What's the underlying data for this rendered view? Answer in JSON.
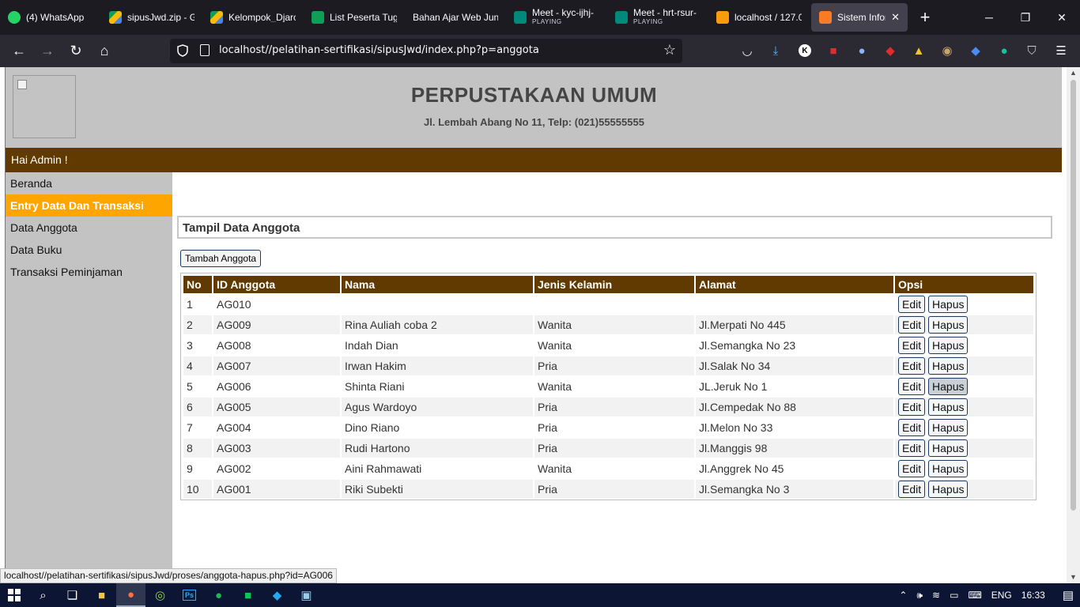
{
  "browser": {
    "tabs": [
      {
        "title": "(4) WhatsApp",
        "sub": "",
        "color": "#25d366"
      },
      {
        "title": "sipusJwd.zip - G",
        "sub": "",
        "color": "#fbbc04"
      },
      {
        "title": "Kelompok_Djarc",
        "sub": "",
        "color": "#34a853"
      },
      {
        "title": "List Peserta Tug",
        "sub": "",
        "color": "#0f9d58"
      },
      {
        "title": "Bahan Ajar Web Jun",
        "sub": "",
        "color": ""
      },
      {
        "title": "Meet - kyc-ijhj-",
        "sub": "PLAYING",
        "color": "#00897b"
      },
      {
        "title": "Meet - hrt-rsur-",
        "sub": "PLAYING",
        "color": "#00897b"
      },
      {
        "title": "localhost / 127.0",
        "sub": "",
        "color": "#f89c0e"
      },
      {
        "title": "Sistem Inform",
        "sub": "",
        "color": "#fb7a24"
      }
    ],
    "url": "localhost//pelatihan-sertifikasi/sipusJwd/index.php?p=anggota",
    "status_link": "localhost//pelatihan-sertifikasi/sipusJwd/proses/anggota-hapus.php?id=AG006"
  },
  "header": {
    "title": "PERPUSTAKAAN UMUM",
    "subtitle": "Jl. Lembah Abang No 11, Telp: (021)55555555"
  },
  "welcome": "Hai Admin !",
  "sidebar": {
    "items": [
      {
        "label": "Beranda"
      },
      {
        "label": "Entry Data Dan Transaksi"
      },
      {
        "label": "Data Anggota"
      },
      {
        "label": "Data Buku"
      },
      {
        "label": "Transaksi Peminjaman"
      }
    ]
  },
  "main": {
    "panel_title": "Tampil Data Anggota",
    "add_button": "Tambah Anggota",
    "columns": [
      "No",
      "ID Anggota",
      "Nama",
      "Jenis Kelamin",
      "Alamat",
      "Opsi"
    ],
    "edit_label": "Edit",
    "delete_label": "Hapus",
    "rows": [
      {
        "no": "1",
        "id": "AG010",
        "nama": "",
        "jk": "",
        "alamat": ""
      },
      {
        "no": "2",
        "id": "AG009",
        "nama": "Rina Auliah coba 2",
        "jk": "Wanita",
        "alamat": "Jl.Merpati No 445"
      },
      {
        "no": "3",
        "id": "AG008",
        "nama": "Indah Dian",
        "jk": "Wanita",
        "alamat": "Jl.Semangka No 23"
      },
      {
        "no": "4",
        "id": "AG007",
        "nama": "Irwan Hakim",
        "jk": "Pria",
        "alamat": "Jl.Salak No 34"
      },
      {
        "no": "5",
        "id": "AG006",
        "nama": "Shinta Riani",
        "jk": "Wanita",
        "alamat": "JL.Jeruk No 1"
      },
      {
        "no": "6",
        "id": "AG005",
        "nama": "Agus Wardoyo",
        "jk": "Pria",
        "alamat": "Jl.Cempedak No 88"
      },
      {
        "no": "7",
        "id": "AG004",
        "nama": "Dino Riano",
        "jk": "Pria",
        "alamat": "Jl.Melon No 33"
      },
      {
        "no": "8",
        "id": "AG003",
        "nama": "Rudi Hartono",
        "jk": "Pria",
        "alamat": "Jl.Manggis 98"
      },
      {
        "no": "9",
        "id": "AG002",
        "nama": "Aini Rahmawati",
        "jk": "Wanita",
        "alamat": "Jl.Anggrek No 45"
      },
      {
        "no": "10",
        "id": "AG001",
        "nama": "Riki Subekti",
        "jk": "Pria",
        "alamat": "Jl.Semangka No 3"
      }
    ]
  },
  "taskbar": {
    "lang": "ENG",
    "time": "16:33"
  }
}
